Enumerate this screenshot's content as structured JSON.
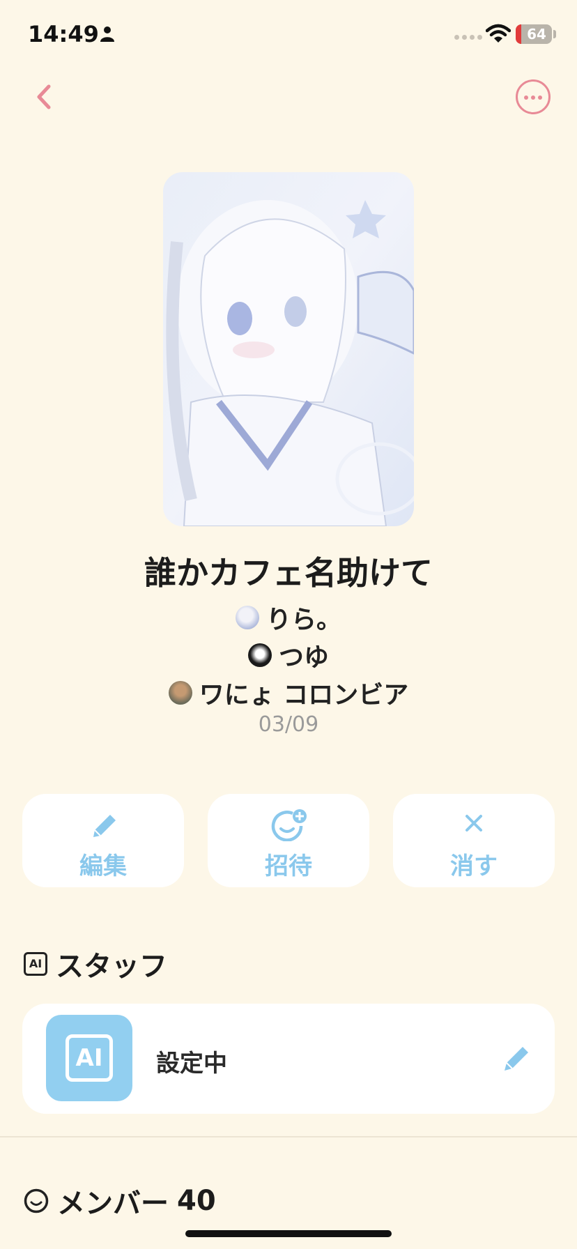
{
  "status_bar": {
    "time": "14:49",
    "battery": "64"
  },
  "header": {
    "back_icon": "chevron-left-icon",
    "more_icon": "ellipsis-circle-icon"
  },
  "room": {
    "title": "誰かカフェ名助けて",
    "members": [
      {
        "name": "りら。"
      },
      {
        "name": "つゆ"
      },
      {
        "name": "ワにょ コロンビア"
      }
    ],
    "date": "03/09"
  },
  "actions": [
    {
      "label": "編集",
      "icon": "pencil-icon"
    },
    {
      "label": "招待",
      "icon": "add-face-icon"
    },
    {
      "label": "消す",
      "icon": "close-icon"
    }
  ],
  "staff": {
    "section_title": "スタッフ",
    "icon_text": "AI",
    "status": "設定中"
  },
  "members_section": {
    "title": "メンバー",
    "count": "40"
  },
  "colors": {
    "background": "#fdf7e8",
    "accent_blue": "#8ac8ec",
    "accent_pink": "#e88a96",
    "card": "#ffffff"
  }
}
